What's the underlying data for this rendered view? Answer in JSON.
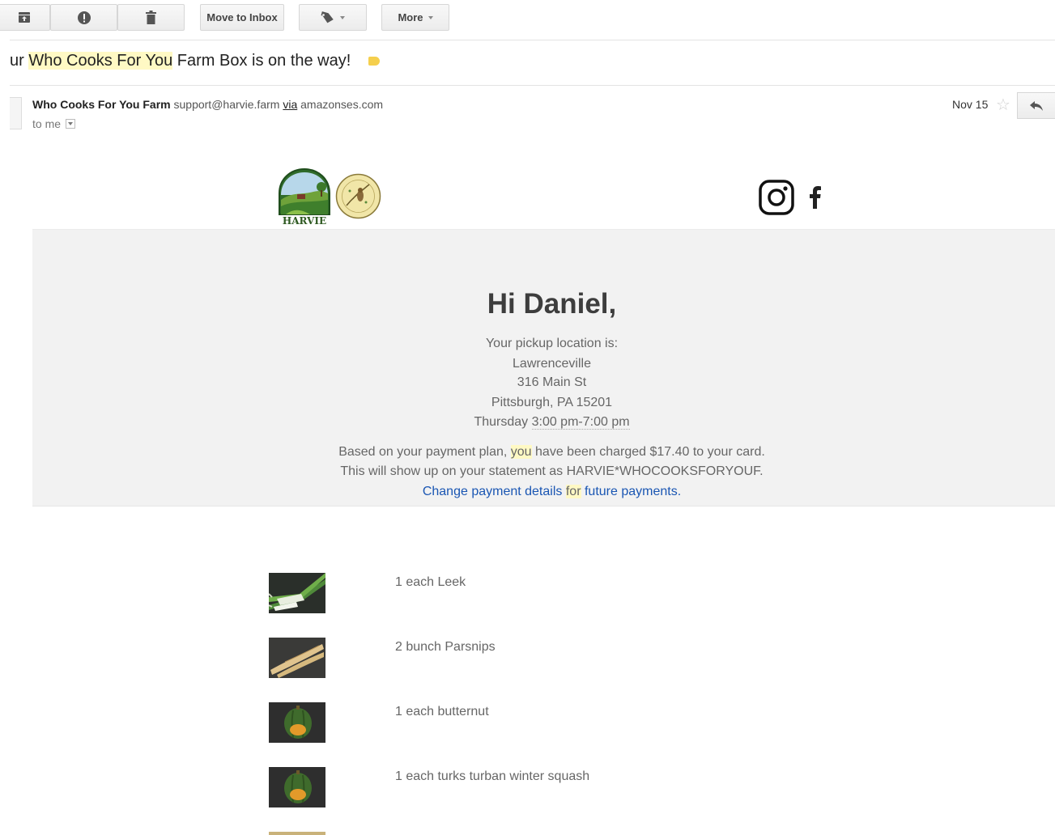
{
  "toolbar": {
    "move_to_inbox_label": "Move to Inbox",
    "more_label": "More",
    "icons": [
      "archive-icon",
      "report-spam-icon",
      "delete-icon",
      "label-icon"
    ]
  },
  "email": {
    "subject_prefix": "ur ",
    "subject_highlight": "Who Cooks For You",
    "subject_suffix": " Farm Box is on the way!",
    "sender_name": "Who Cooks For You Farm",
    "sender_email": "support@harvie.farm",
    "via_label": "via",
    "via_domain": "amazonses.com",
    "to_label": "to me",
    "date": "Nov 15"
  },
  "body": {
    "brand": "HARVIE",
    "greeting": "Hi Daniel,",
    "pickup_intro": "Your pickup location is:",
    "pickup_name": "Lawrenceville",
    "pickup_street": "316 Main St",
    "pickup_city": "Pittsburgh, PA 15201",
    "pickup_day": "Thursday",
    "pickup_time": "3:00 pm-7:00 pm",
    "charge_before": "Based on your payment plan, ",
    "charge_you": "you",
    "charge_after": " have been charged $17.40 to your card.",
    "statement_line": "This will show up on your statement as HARVIE*WHOCOOKSFORYOUF.",
    "change_payment_link": "Change payment details",
    "for_word": "for",
    "future_payments_link": "future payments",
    "period": "."
  },
  "items": [
    {
      "text": "1 each Leek",
      "image": "leek-image"
    },
    {
      "text": "2 bunch Parsnips",
      "image": "parsnips-image"
    },
    {
      "text": "1 each butternut",
      "image": "squash-image"
    },
    {
      "text": "1 each turks turban winter squash",
      "image": "squash-image"
    }
  ],
  "colors": {
    "link": "#1a56b3",
    "highlight": "#fff9c4",
    "panel": "#f2f2f2",
    "label_tag": "#f5cf4d"
  }
}
